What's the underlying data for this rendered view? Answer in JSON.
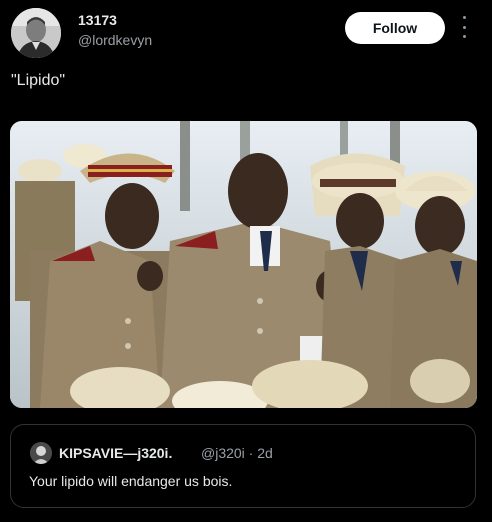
{
  "author": {
    "display_name": "13173",
    "handle": "@lordkevyn",
    "avatar_icon": "profile-photo"
  },
  "follow_button": {
    "label": "Follow"
  },
  "more_menu": {
    "icon": "more-vertical-icon"
  },
  "tweet": {
    "text": "\"Lipido\""
  },
  "media": {
    "description_icon": "photo"
  },
  "quote": {
    "author_name": "KIPSAVIE—j320i.",
    "handle_and_time": "@j320i · 2d",
    "text": "Your lipido will endanger us bois.",
    "avatar_icon": "profile-photo"
  },
  "colors": {
    "background": "#000000",
    "text": "#e7e9ea",
    "muted": "#9aa0a6",
    "border": "#2f3336",
    "follow_bg": "#ffffff"
  }
}
